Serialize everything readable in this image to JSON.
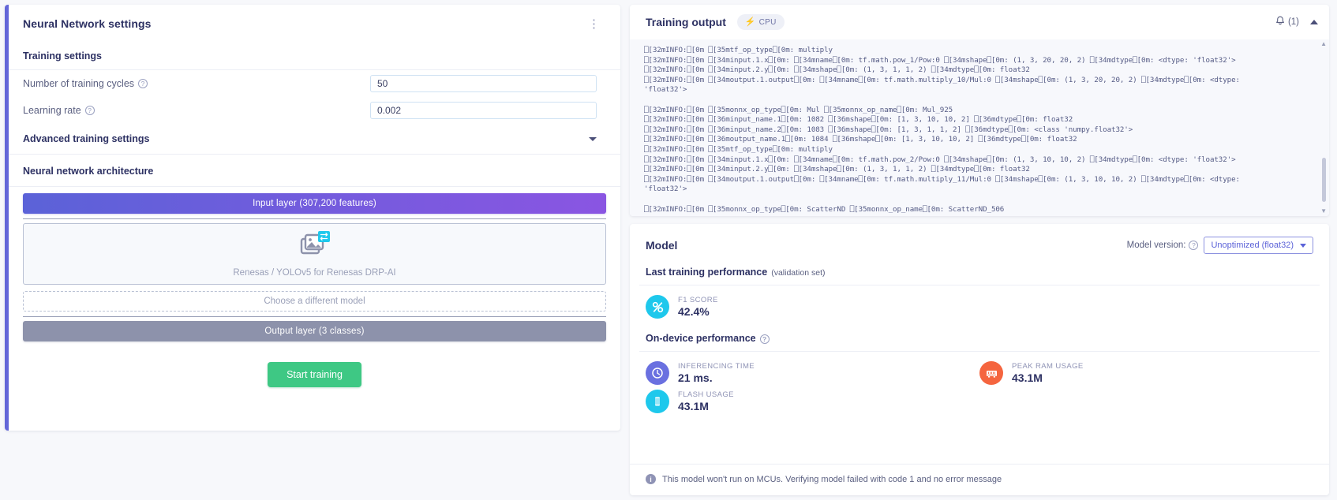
{
  "nn_panel": {
    "title": "Neural Network settings",
    "menu_icon": "kebab-menu-icon",
    "training_settings_label": "Training settings",
    "fields": [
      {
        "label": "Number of training cycles",
        "value": "50",
        "help": "?"
      },
      {
        "label": "Learning rate",
        "value": "0.002",
        "help": "?"
      }
    ],
    "advanced_label": "Advanced training settings",
    "architecture_label": "Neural network architecture",
    "input_layer": "Input layer (307,200 features)",
    "model_name": "Renesas / YOLOv5 for Renesas DRP-AI",
    "model_icon": "image-transfer-icon",
    "choose_model": "Choose a different model",
    "output_layer": "Output layer (3 classes)",
    "start_training": "Start training"
  },
  "training_output": {
    "title": "Training output",
    "device_badge": "CPU",
    "device_icon": "bolt-icon",
    "bell_icon": "bell-icon",
    "bell_count": "(1)",
    "collapse_icon": "chevron-up-icon",
    "lines": [
      "\u001b[32mINFO:\u001b[0m \u001b[35mtf_op_type\u001b[0m: multiply",
      "\u001b[32mINFO:\u001b[0m \u001b[34minput.1.x\u001b[0m: \u001b[34mname\u001b[0m: tf.math.pow_1/Pow:0 \u001b[34mshape\u001b[0m: (1, 3, 20, 20, 2) \u001b[34mdtype\u001b[0m: <dtype: 'float32'>",
      "\u001b[32mINFO:\u001b[0m \u001b[34minput.2.y\u001b[0m: \u001b[34mshape\u001b[0m: (1, 3, 1, 1, 2) \u001b[34mdtype\u001b[0m: float32",
      "\u001b[32mINFO:\u001b[0m \u001b[34moutput.1.output\u001b[0m: \u001b[34mname\u001b[0m: tf.math.multiply_10/Mul:0 \u001b[34mshape\u001b[0m: (1, 3, 20, 20, 2) \u001b[34mdtype\u001b[0m: <dtype:",
      "'float32'>",
      "",
      "\u001b[32mINFO:\u001b[0m \u001b[35monnx_op_type\u001b[0m: Mul \u001b[35monnx_op_name\u001b[0m: Mul_925",
      "\u001b[32mINFO:\u001b[0m \u001b[36minput_name.1\u001b[0m: 1082 \u001b[36mshape\u001b[0m: [1, 3, 10, 10, 2] \u001b[36mdtype\u001b[0m: float32",
      "\u001b[32mINFO:\u001b[0m \u001b[36minput_name.2\u001b[0m: 1083 \u001b[36mshape\u001b[0m: [1, 3, 1, 1, 2] \u001b[36mdtype\u001b[0m: <class 'numpy.float32'>",
      "\u001b[32mINFO:\u001b[0m \u001b[36moutput_name.1\u001b[0m: 1084 \u001b[36mshape\u001b[0m: [1, 3, 10, 10, 2] \u001b[36mdtype\u001b[0m: float32",
      "\u001b[32mINFO:\u001b[0m \u001b[35mtf_op_type\u001b[0m: multiply",
      "\u001b[32mINFO:\u001b[0m \u001b[34minput.1.x\u001b[0m: \u001b[34mname\u001b[0m: tf.math.pow_2/Pow:0 \u001b[34mshape\u001b[0m: (1, 3, 10, 10, 2) \u001b[34mdtype\u001b[0m: <dtype: 'float32'>",
      "\u001b[32mINFO:\u001b[0m \u001b[34minput.2.y\u001b[0m: \u001b[34mshape\u001b[0m: (1, 3, 1, 1, 2) \u001b[34mdtype\u001b[0m: float32",
      "\u001b[32mINFO:\u001b[0m \u001b[34moutput.1.output\u001b[0m: \u001b[34mname\u001b[0m: tf.math.multiply_11/Mul:0 \u001b[34mshape\u001b[0m: (1, 3, 10, 10, 2) \u001b[34mdtype\u001b[0m: <dtype:",
      "'float32'>",
      "",
      "\u001b[32mINFO:\u001b[0m \u001b[35monnx_op_type\u001b[0m: ScatterND \u001b[35monnx_op_name\u001b[0m: ScatterND_506"
    ]
  },
  "model_panel": {
    "title": "Model",
    "version_label": "Model version:",
    "version_value": "Unoptimized (float32)",
    "last_training_title": "Last training performance",
    "last_training_sub": "(validation set)",
    "f1": {
      "label": "F1 SCORE",
      "value": "42.4%",
      "icon": "percent-icon",
      "color": "#1ec8ec"
    },
    "on_device_title": "On-device performance",
    "metrics": [
      {
        "label": "INFERENCING TIME",
        "value": "21 ms.",
        "icon": "clock-icon",
        "color": "#6a70e0"
      },
      {
        "label": "FLASH USAGE",
        "value": "43.1M",
        "icon": "chip-icon",
        "color": "#1ec8ec"
      },
      {
        "label": "PEAK RAM USAGE",
        "value": "43.1M",
        "icon": "ram-icon",
        "color": "#f5653f"
      }
    ],
    "note": "This model won't run on MCUs. Verifying model failed with code 1 and no error message"
  }
}
